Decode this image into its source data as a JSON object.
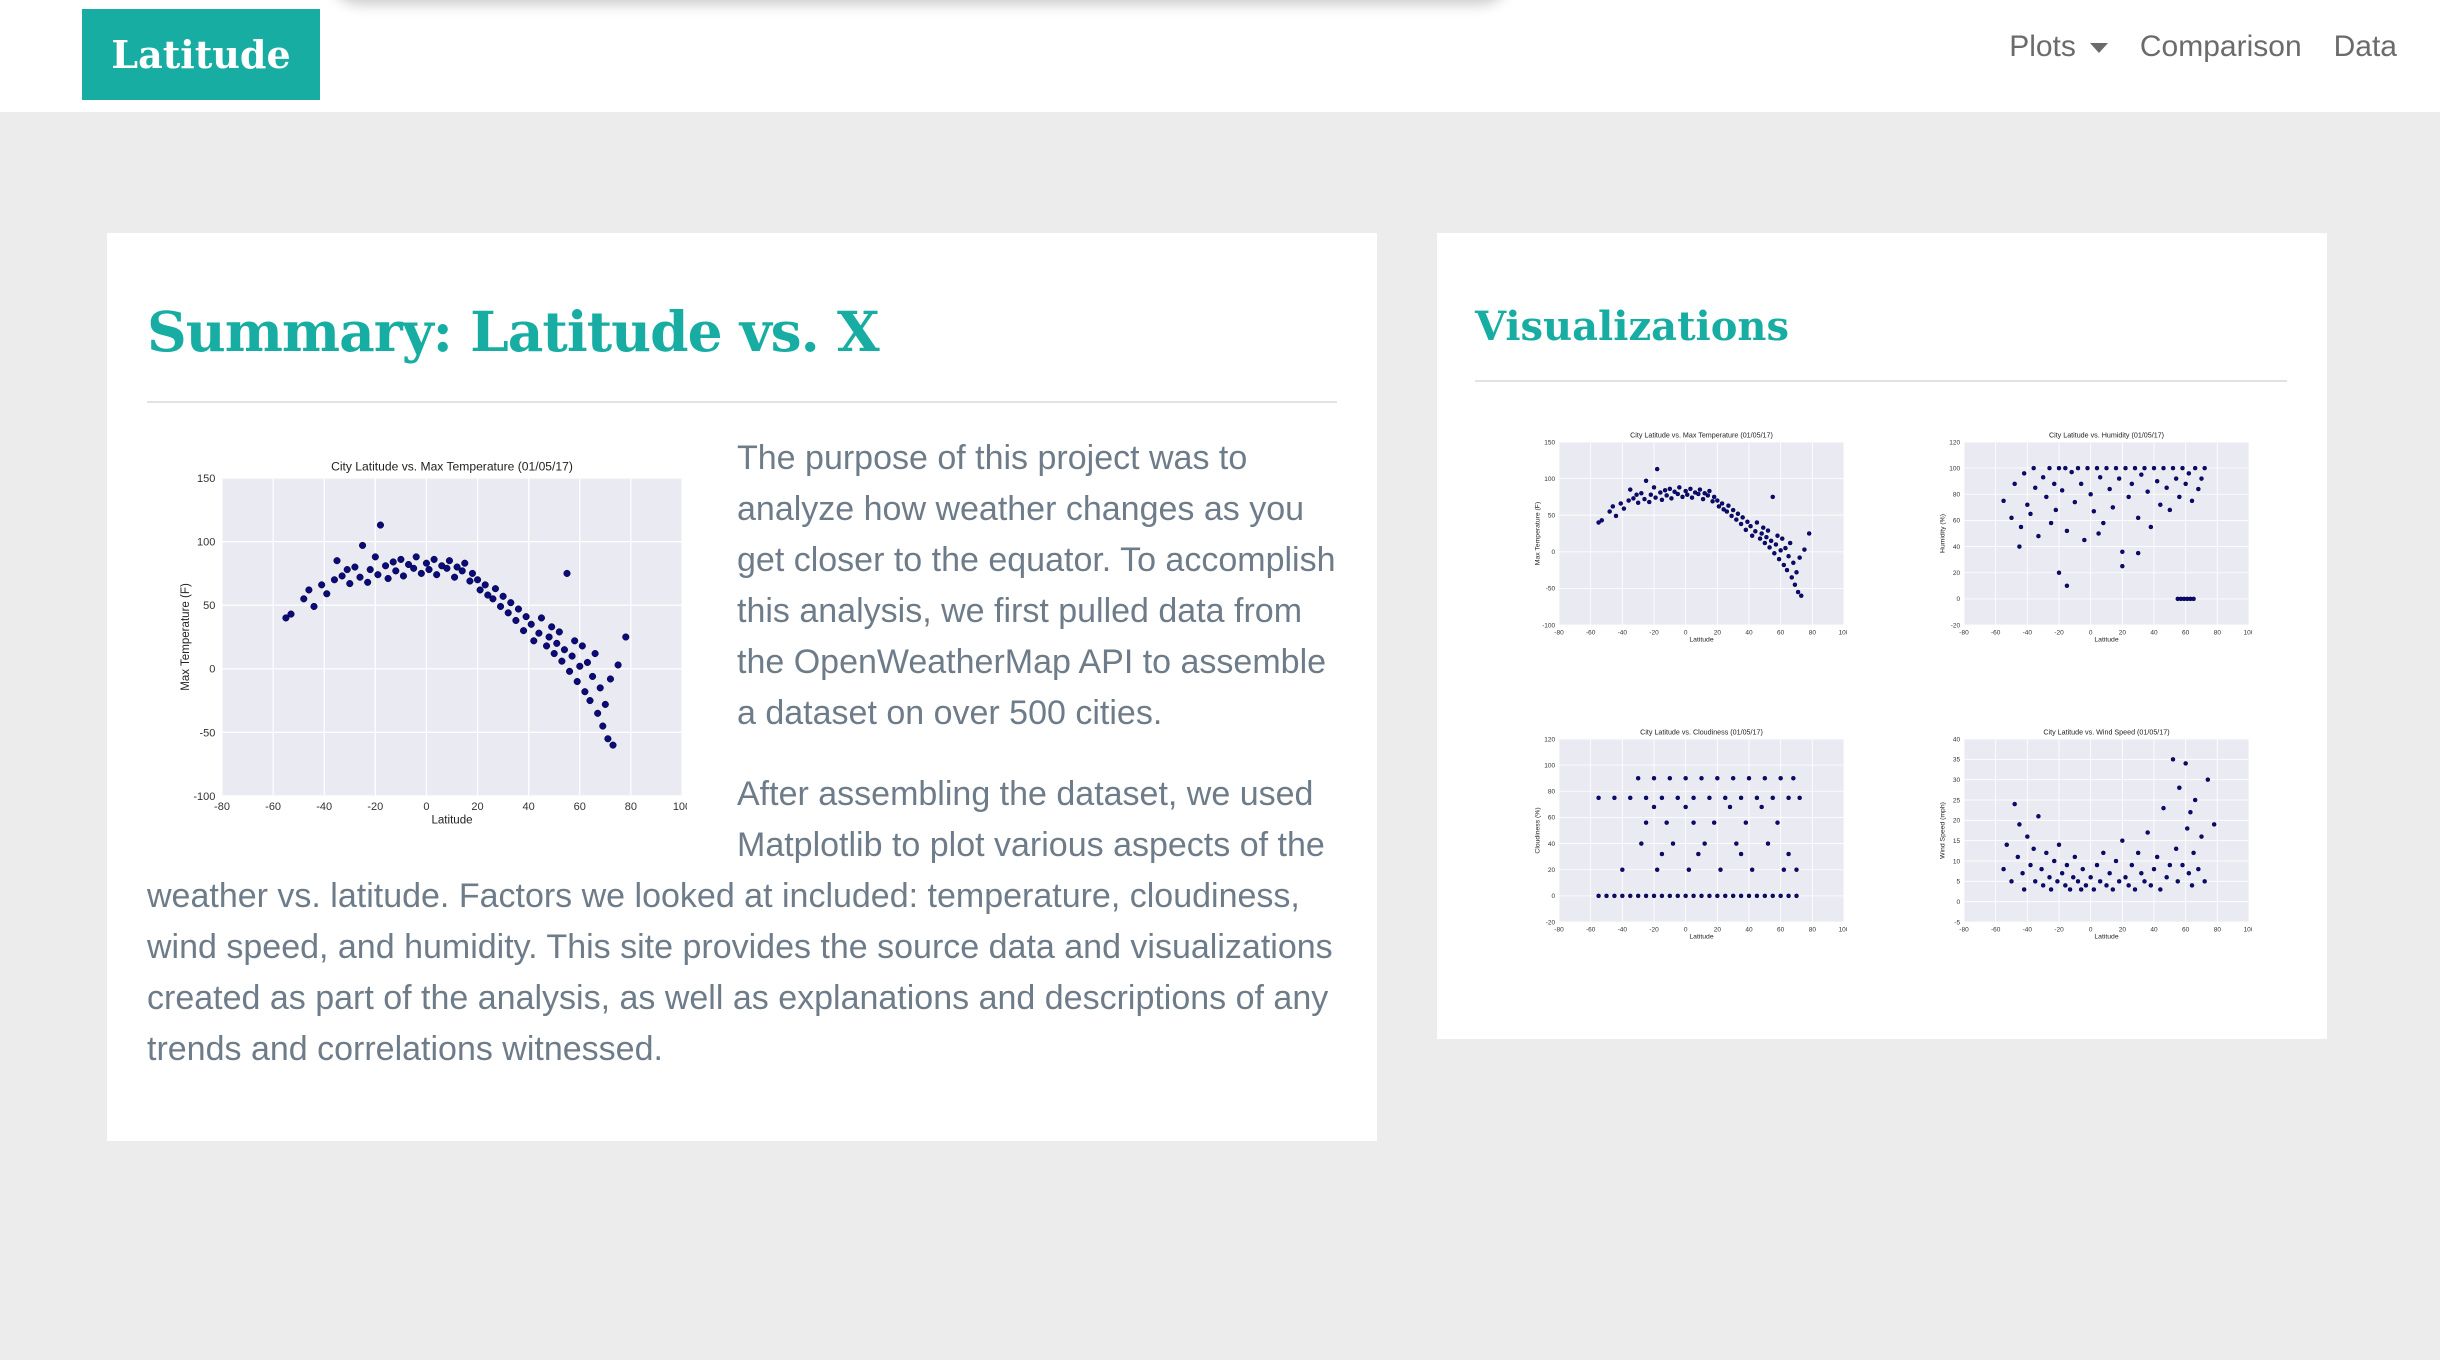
{
  "navbar": {
    "brand": "Latitude",
    "links": {
      "plots": "Plots",
      "comparison": "Comparison",
      "data": "Data"
    }
  },
  "summary": {
    "title": "Summary: Latitude vs. X",
    "paragraph1": "The purpose of this project was to analyze how weather changes as you get closer to the equator. To accomplish this analysis, we first pulled data from the OpenWeatherMap API to assemble a dataset on over 500 cities.",
    "paragraph2": "After assembling the dataset, we used Matplotlib to plot various aspects of the weather vs. latitude. Factors we looked at included: temperature, cloudiness, wind speed, and humidity. This site provides the source data and visualizations created as part of the analysis, as well as explanations and descriptions of any trends and correlations witnessed."
  },
  "visualizations": {
    "title": "Visualizations"
  },
  "colors": {
    "accent": "#17ada3",
    "text": "#6e7c8a",
    "nav_text": "#6b6b6b",
    "background": "#ececec",
    "plot_bg": "#eaeaf2",
    "marker": "#0a0a7a"
  },
  "chart_data": [
    {
      "id": "temp",
      "type": "scatter",
      "title": "City Latitude vs. Max Temperature (01/05/17)",
      "xlabel": "Latitude",
      "ylabel": "Max Temperature (F)",
      "xlim": [
        -80,
        100
      ],
      "ylim": [
        -100,
        150
      ],
      "xticks": [
        -80,
        -60,
        -40,
        -20,
        0,
        20,
        40,
        60,
        80,
        100
      ],
      "yticks": [
        -100,
        -50,
        0,
        50,
        100,
        150
      ],
      "grid": true,
      "points": [
        [
          -55,
          40
        ],
        [
          -53,
          43
        ],
        [
          -48,
          55
        ],
        [
          -46,
          62
        ],
        [
          -44,
          49
        ],
        [
          -41,
          66
        ],
        [
          -39,
          59
        ],
        [
          -36,
          70
        ],
        [
          -35,
          85
        ],
        [
          -33,
          73
        ],
        [
          -31,
          78
        ],
        [
          -30,
          67
        ],
        [
          -28,
          80
        ],
        [
          -26,
          72
        ],
        [
          -25,
          97
        ],
        [
          -23,
          68
        ],
        [
          -22,
          78
        ],
        [
          -20,
          88
        ],
        [
          -19,
          74
        ],
        [
          -18,
          113
        ],
        [
          -16,
          81
        ],
        [
          -15,
          71
        ],
        [
          -13,
          84
        ],
        [
          -12,
          77
        ],
        [
          -10,
          86
        ],
        [
          -9,
          73
        ],
        [
          -7,
          82
        ],
        [
          -5,
          79
        ],
        [
          -4,
          88
        ],
        [
          -2,
          75
        ],
        [
          0,
          83
        ],
        [
          1,
          78
        ],
        [
          3,
          86
        ],
        [
          4,
          74
        ],
        [
          6,
          81
        ],
        [
          8,
          79
        ],
        [
          9,
          85
        ],
        [
          11,
          72
        ],
        [
          12,
          80
        ],
        [
          14,
          77
        ],
        [
          15,
          83
        ],
        [
          17,
          69
        ],
        [
          18,
          75
        ],
        [
          20,
          70
        ],
        [
          21,
          62
        ],
        [
          23,
          66
        ],
        [
          24,
          58
        ],
        [
          26,
          55
        ],
        [
          27,
          63
        ],
        [
          29,
          49
        ],
        [
          30,
          57
        ],
        [
          32,
          44
        ],
        [
          33,
          52
        ],
        [
          35,
          38
        ],
        [
          36,
          47
        ],
        [
          38,
          30
        ],
        [
          39,
          41
        ],
        [
          41,
          35
        ],
        [
          42,
          22
        ],
        [
          44,
          28
        ],
        [
          45,
          40
        ],
        [
          47,
          18
        ],
        [
          48,
          25
        ],
        [
          49,
          33
        ],
        [
          50,
          12
        ],
        [
          51,
          20
        ],
        [
          52,
          29
        ],
        [
          53,
          6
        ],
        [
          54,
          15
        ],
        [
          55,
          75
        ],
        [
          56,
          -2
        ],
        [
          57,
          10
        ],
        [
          58,
          22
        ],
        [
          59,
          -10
        ],
        [
          60,
          2
        ],
        [
          61,
          18
        ],
        [
          62,
          -18
        ],
        [
          63,
          5
        ],
        [
          64,
          -25
        ],
        [
          65,
          -6
        ],
        [
          66,
          12
        ],
        [
          67,
          -35
        ],
        [
          68,
          -15
        ],
        [
          69,
          -45
        ],
        [
          70,
          -28
        ],
        [
          71,
          -55
        ],
        [
          72,
          -8
        ],
        [
          73,
          -60
        ],
        [
          75,
          3
        ],
        [
          78,
          25
        ]
      ]
    },
    {
      "id": "humidity",
      "type": "scatter",
      "title": "City Latitude vs. Humidity (01/05/17)",
      "xlabel": "Latitude",
      "ylabel": "Humidity (%)",
      "xlim": [
        -80,
        100
      ],
      "ylim": [
        -20,
        120
      ],
      "xticks": [
        -80,
        -60,
        -40,
        -20,
        0,
        20,
        40,
        60,
        80,
        100
      ],
      "yticks": [
        -20,
        0,
        20,
        40,
        60,
        80,
        100,
        120
      ],
      "grid": true,
      "points": [
        [
          -55,
          75
        ],
        [
          -50,
          62
        ],
        [
          -48,
          88
        ],
        [
          -45,
          40
        ],
        [
          -44,
          55
        ],
        [
          -42,
          96
        ],
        [
          -40,
          72
        ],
        [
          -38,
          65
        ],
        [
          -36,
          100
        ],
        [
          -35,
          85
        ],
        [
          -33,
          48
        ],
        [
          -30,
          93
        ],
        [
          -28,
          78
        ],
        [
          -26,
          100
        ],
        [
          -25,
          58
        ],
        [
          -23,
          88
        ],
        [
          -22,
          68
        ],
        [
          -20,
          100
        ],
        [
          -18,
          83
        ],
        [
          -16,
          100
        ],
        [
          -15,
          52
        ],
        [
          -12,
          97
        ],
        [
          -10,
          74
        ],
        [
          -8,
          100
        ],
        [
          -6,
          88
        ],
        [
          -4,
          45
        ],
        [
          -2,
          100
        ],
        [
          0,
          80
        ],
        [
          2,
          67
        ],
        [
          4,
          100
        ],
        [
          6,
          93
        ],
        [
          8,
          58
        ],
        [
          10,
          100
        ],
        [
          12,
          84
        ],
        [
          14,
          70
        ],
        [
          16,
          100
        ],
        [
          18,
          92
        ],
        [
          20,
          36
        ],
        [
          22,
          100
        ],
        [
          24,
          78
        ],
        [
          26,
          88
        ],
        [
          28,
          100
        ],
        [
          30,
          62
        ],
        [
          32,
          95
        ],
        [
          34,
          100
        ],
        [
          36,
          82
        ],
        [
          38,
          55
        ],
        [
          40,
          100
        ],
        [
          42,
          90
        ],
        [
          44,
          72
        ],
        [
          46,
          100
        ],
        [
          48,
          85
        ],
        [
          50,
          68
        ],
        [
          52,
          100
        ],
        [
          54,
          92
        ],
        [
          56,
          78
        ],
        [
          58,
          100
        ],
        [
          60,
          88
        ],
        [
          62,
          96
        ],
        [
          64,
          75
        ],
        [
          66,
          100
        ],
        [
          68,
          84
        ],
        [
          70,
          92
        ],
        [
          72,
          100
        ],
        [
          55,
          0
        ],
        [
          57,
          0
        ],
        [
          59,
          0
        ],
        [
          61,
          0
        ],
        [
          63,
          0
        ],
        [
          65,
          0
        ],
        [
          -20,
          20
        ],
        [
          -15,
          10
        ],
        [
          20,
          25
        ],
        [
          30,
          35
        ],
        [
          5,
          50
        ]
      ]
    },
    {
      "id": "cloudiness",
      "type": "scatter",
      "title": "City Latitude vs. Cloudiness (01/05/17)",
      "xlabel": "Latitude",
      "ylabel": "Cloudiness (%)",
      "xlim": [
        -80,
        100
      ],
      "ylim": [
        -20,
        120
      ],
      "xticks": [
        -80,
        -60,
        -40,
        -20,
        0,
        20,
        40,
        60,
        80,
        100
      ],
      "yticks": [
        -20,
        0,
        20,
        40,
        60,
        80,
        100,
        120
      ],
      "grid": true,
      "points": [
        [
          -55,
          0
        ],
        [
          -50,
          0
        ],
        [
          -45,
          0
        ],
        [
          -40,
          0
        ],
        [
          -35,
          0
        ],
        [
          -30,
          0
        ],
        [
          -25,
          0
        ],
        [
          -20,
          0
        ],
        [
          -15,
          0
        ],
        [
          -10,
          0
        ],
        [
          -5,
          0
        ],
        [
          0,
          0
        ],
        [
          5,
          0
        ],
        [
          10,
          0
        ],
        [
          15,
          0
        ],
        [
          20,
          0
        ],
        [
          25,
          0
        ],
        [
          30,
          0
        ],
        [
          35,
          0
        ],
        [
          40,
          0
        ],
        [
          45,
          0
        ],
        [
          50,
          0
        ],
        [
          55,
          0
        ],
        [
          60,
          0
        ],
        [
          65,
          0
        ],
        [
          70,
          0
        ],
        [
          -55,
          75
        ],
        [
          -45,
          75
        ],
        [
          -35,
          75
        ],
        [
          -25,
          75
        ],
        [
          -15,
          75
        ],
        [
          -5,
          75
        ],
        [
          5,
          75
        ],
        [
          15,
          75
        ],
        [
          25,
          75
        ],
        [
          35,
          75
        ],
        [
          45,
          75
        ],
        [
          55,
          75
        ],
        [
          65,
          75
        ],
        [
          72,
          75
        ],
        [
          -30,
          90
        ],
        [
          -20,
          90
        ],
        [
          -10,
          90
        ],
        [
          0,
          90
        ],
        [
          10,
          90
        ],
        [
          20,
          90
        ],
        [
          30,
          90
        ],
        [
          40,
          90
        ],
        [
          50,
          90
        ],
        [
          60,
          90
        ],
        [
          68,
          90
        ],
        [
          -28,
          40
        ],
        [
          -18,
          20
        ],
        [
          -8,
          40
        ],
        [
          2,
          20
        ],
        [
          12,
          40
        ],
        [
          22,
          20
        ],
        [
          32,
          40
        ],
        [
          42,
          20
        ],
        [
          52,
          40
        ],
        [
          62,
          20
        ],
        [
          -25,
          56
        ],
        [
          -12,
          56
        ],
        [
          5,
          56
        ],
        [
          18,
          56
        ],
        [
          38,
          56
        ],
        [
          58,
          56
        ],
        [
          -20,
          68
        ],
        [
          0,
          68
        ],
        [
          28,
          68
        ],
        [
          48,
          68
        ],
        [
          -15,
          32
        ],
        [
          8,
          32
        ],
        [
          35,
          32
        ],
        [
          65,
          32
        ],
        [
          -40,
          20
        ],
        [
          70,
          20
        ]
      ]
    },
    {
      "id": "wind",
      "type": "scatter",
      "title": "City Latitude vs. Wind Speed (01/05/17)",
      "xlabel": "Latitude",
      "ylabel": "Wind Speed (mph)",
      "xlim": [
        -80,
        100
      ],
      "ylim": [
        -5,
        40
      ],
      "xticks": [
        -80,
        -60,
        -40,
        -20,
        0,
        20,
        40,
        60,
        80,
        100
      ],
      "yticks": [
        -5,
        0,
        5,
        10,
        15,
        20,
        25,
        30,
        35,
        40
      ],
      "grid": true,
      "points": [
        [
          -55,
          8
        ],
        [
          -53,
          14
        ],
        [
          -50,
          5
        ],
        [
          -48,
          24
        ],
        [
          -46,
          11
        ],
        [
          -45,
          19
        ],
        [
          -43,
          7
        ],
        [
          -42,
          3
        ],
        [
          -40,
          16
        ],
        [
          -38,
          9
        ],
        [
          -36,
          13
        ],
        [
          -35,
          5
        ],
        [
          -33,
          21
        ],
        [
          -31,
          8
        ],
        [
          -30,
          4
        ],
        [
          -28,
          12
        ],
        [
          -26,
          6
        ],
        [
          -25,
          3
        ],
        [
          -23,
          10
        ],
        [
          -21,
          5
        ],
        [
          -20,
          14
        ],
        [
          -18,
          7
        ],
        [
          -16,
          4
        ],
        [
          -15,
          9
        ],
        [
          -13,
          3
        ],
        [
          -11,
          6
        ],
        [
          -10,
          11
        ],
        [
          -8,
          5
        ],
        [
          -6,
          3
        ],
        [
          -5,
          8
        ],
        [
          -3,
          4
        ],
        [
          0,
          6
        ],
        [
          2,
          3
        ],
        [
          4,
          9
        ],
        [
          6,
          5
        ],
        [
          8,
          12
        ],
        [
          10,
          4
        ],
        [
          12,
          7
        ],
        [
          14,
          3
        ],
        [
          16,
          10
        ],
        [
          18,
          5
        ],
        [
          20,
          15
        ],
        [
          22,
          6
        ],
        [
          24,
          4
        ],
        [
          26,
          9
        ],
        [
          28,
          3
        ],
        [
          30,
          12
        ],
        [
          32,
          7
        ],
        [
          34,
          5
        ],
        [
          36,
          17
        ],
        [
          38,
          4
        ],
        [
          40,
          8
        ],
        [
          42,
          11
        ],
        [
          44,
          3
        ],
        [
          46,
          23
        ],
        [
          48,
          6
        ],
        [
          50,
          9
        ],
        [
          52,
          35
        ],
        [
          54,
          13
        ],
        [
          55,
          5
        ],
        [
          56,
          28
        ],
        [
          58,
          9
        ],
        [
          60,
          34
        ],
        [
          61,
          18
        ],
        [
          62,
          7
        ],
        [
          63,
          22
        ],
        [
          64,
          4
        ],
        [
          65,
          12
        ],
        [
          66,
          25
        ],
        [
          68,
          8
        ],
        [
          70,
          16
        ],
        [
          72,
          5
        ],
        [
          74,
          30
        ],
        [
          78,
          19
        ]
      ]
    }
  ]
}
